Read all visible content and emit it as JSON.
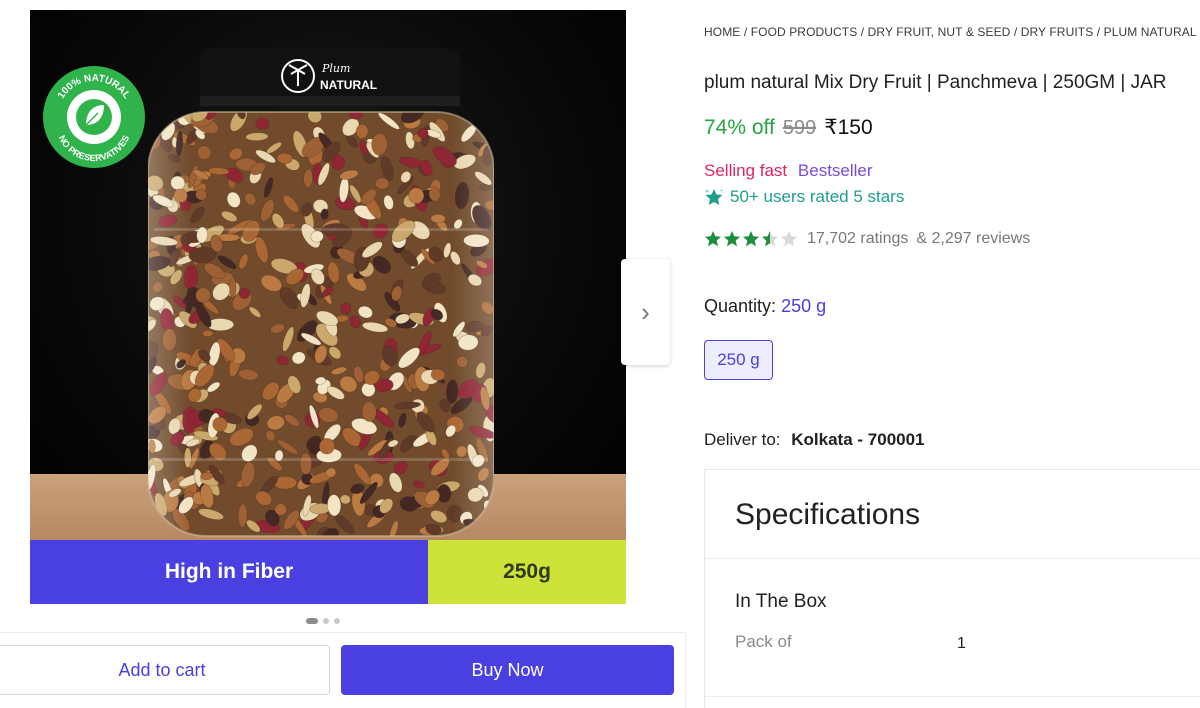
{
  "gallery": {
    "jar_brand_top": "Plum",
    "jar_brand_bottom": "NATURAL",
    "badge_top": "100% NATURAL",
    "badge_bottom": "NO PRESERVATIVES",
    "strip_left": "High in Fiber",
    "strip_right": "250g",
    "next_icon": "chevron-right-icon",
    "current_slide": 1,
    "total_slides": 3
  },
  "actions": {
    "add_to_cart": "Add to cart",
    "buy_now": "Buy Now"
  },
  "breadcrumb": "HOME / FOOD PRODUCTS / DRY FRUIT, NUT & SEED / DRY FRUITS / PLUM NATURAL",
  "product": {
    "title": "plum natural Mix Dry Fruit | Panchmeva | 250GM | JAR",
    "discount": "74% off",
    "mrp": "599",
    "price": "₹150",
    "tag_fast": "Selling fast",
    "tag_best": "Bestseller",
    "rated_text": "50+ users rated 5 stars",
    "rating_value": 3.5,
    "ratings_count": "17,702 ratings",
    "reviews_count": "& 2,297 reviews"
  },
  "quantity": {
    "label": "Quantity:",
    "selected": "250 g",
    "options": [
      "250 g"
    ]
  },
  "delivery": {
    "label": "Deliver to:",
    "location": "Kolkata - 700001"
  },
  "specifications": {
    "title": "Specifications",
    "section": "In The Box",
    "rows": [
      {
        "key": "Pack of",
        "value": "1"
      }
    ]
  },
  "colors": {
    "accent": "#4a3fe0",
    "discount_green": "#26a541",
    "star_green": "#1d8f3c",
    "selling_fast": "#e0245e",
    "bestseller": "#7b4bd6",
    "strip_lime": "#cde33a"
  }
}
